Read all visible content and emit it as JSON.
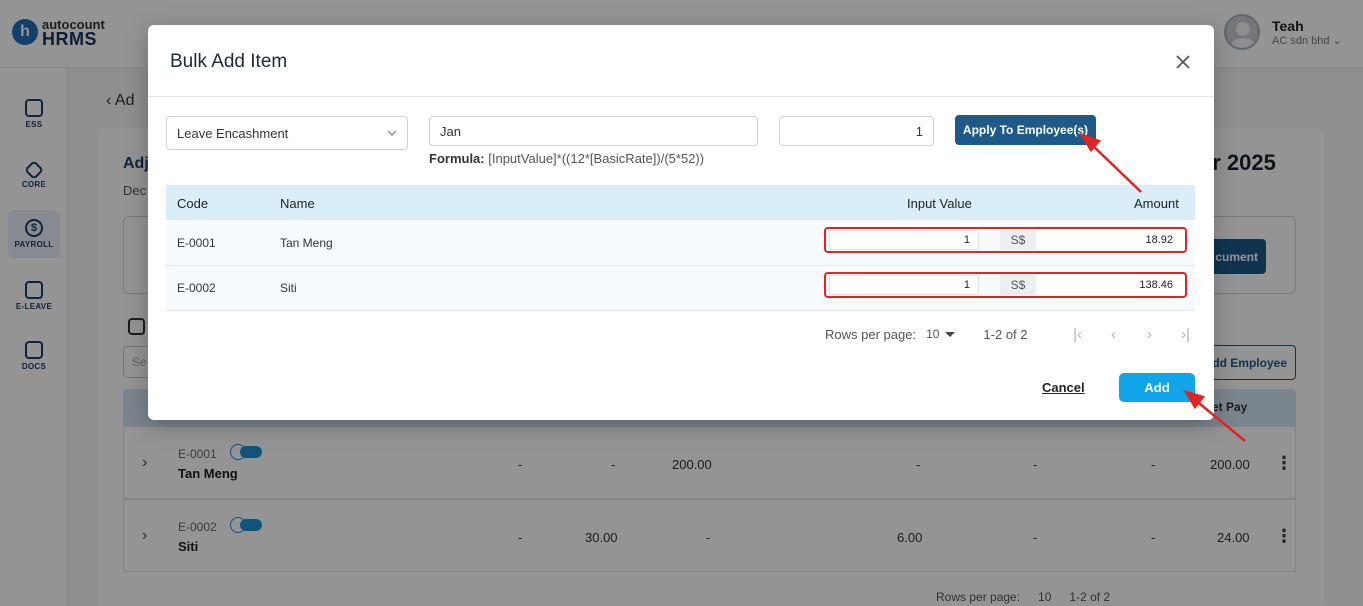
{
  "app": {
    "logo_top": "autocount",
    "logo_bottom": "HRMS",
    "logo_mark": "h",
    "user_name": "Teah",
    "company": "AC sdn bhd ⌄"
  },
  "sidebar": {
    "items": [
      {
        "label": "ESS",
        "icon": "user-card-icon"
      },
      {
        "label": "CORE",
        "icon": "cube-icon"
      },
      {
        "label": "PAYROLL",
        "icon": "dollar-icon",
        "glyph": "$"
      },
      {
        "label": "E-LEAVE",
        "icon": "calendar-icon"
      },
      {
        "label": "DOCS",
        "icon": "document-icon"
      }
    ]
  },
  "background": {
    "back_text": "Ad",
    "heading_left": "Adj",
    "heading_right": "er 2025",
    "subheading": "Dec",
    "doc_button": "cument",
    "search_placeholder": "Se",
    "add_employee": "dd Employee",
    "net_pay_header": "et Pay",
    "rows": [
      {
        "code": "E-0001",
        "name": "Tan Meng",
        "c1": "-",
        "c2": "-",
        "c3": "200.00",
        "c4": "-",
        "c5": "-",
        "c6": "-",
        "net": "200.00"
      },
      {
        "code": "E-0002",
        "name": "Siti",
        "c1": "-",
        "c2": "30.00",
        "c3": "-",
        "c4": "6.00",
        "c5": "-",
        "c6": "-",
        "net": "24.00"
      }
    ],
    "footer": {
      "rows_per_page": "Rows per page:",
      "rows_value": "10",
      "range": "1-2 of 2"
    }
  },
  "modal": {
    "title": "Bulk Add Item",
    "item_select": "Leave Encashment",
    "text_value": "Jan",
    "formula_label": "Formula:",
    "formula_value": "[InputValue]*((12*[BasicRate])/(5*52))",
    "number_value": "1",
    "apply_label": "Apply To Employee(s)",
    "columns": {
      "code": "Code",
      "name": "Name",
      "input_value": "Input Value",
      "amount": "Amount"
    },
    "rows": [
      {
        "code": "E-0001",
        "name": "Tan Meng",
        "input_value": "1",
        "currency": "S$",
        "amount": "18.92"
      },
      {
        "code": "E-0002",
        "name": "Siti",
        "input_value": "1",
        "currency": "S$",
        "amount": "138.46"
      }
    ],
    "pagination": {
      "rows_per_page_label": "Rows per page:",
      "rows_per_page": "10",
      "range": "1-2 of 2"
    },
    "cancel_label": "Cancel",
    "add_label": "Add"
  },
  "colors": {
    "primary": "#1c5a8a",
    "accent": "#10a4e9",
    "highlight": "#e02424",
    "table_header": "#daeefa"
  }
}
